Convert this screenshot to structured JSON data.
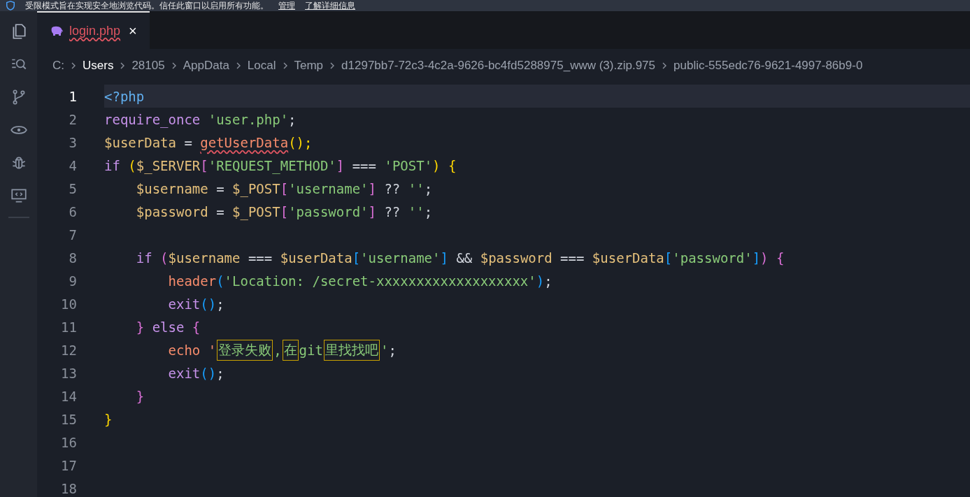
{
  "banner": {
    "message": "受限模式旨在实现安全地浏览代码。信任此窗口以启用所有功能。",
    "links": [
      "管理",
      "了解详细信息"
    ]
  },
  "tabs": [
    {
      "label": "login.php",
      "selected": true,
      "error": true,
      "close": "×"
    }
  ],
  "breadcrumbs": [
    {
      "label": "C:",
      "selected": false
    },
    {
      "label": "Users",
      "selected": true
    },
    {
      "label": "28105",
      "selected": false
    },
    {
      "label": "AppData",
      "selected": false
    },
    {
      "label": "Local",
      "selected": false
    },
    {
      "label": "Temp",
      "selected": false
    },
    {
      "label": "d1297bb7-72c3-4c2a-9626-bc4fd5288975_www (3).zip.975",
      "selected": false
    },
    {
      "label": "public-555edc76-9621-4997-86b9-0",
      "selected": false
    }
  ],
  "lines": [
    {
      "number": "1",
      "active": true,
      "tokens": [
        {
          "text": "<?php",
          "kind": "tag"
        }
      ]
    },
    {
      "number": "2",
      "active": false,
      "tokens": [
        {
          "text": "require_once ",
          "kind": "keyword"
        },
        {
          "text": "'user.php'",
          "kind": "string"
        },
        {
          "text": ";",
          "kind": "plain"
        }
      ]
    },
    {
      "number": "3",
      "active": false,
      "tokens": [
        {
          "text": "$userData",
          "kind": "variable"
        },
        {
          "text": " = ",
          "kind": "plain"
        },
        {
          "text": "getUserData",
          "kind": "function",
          "error": true
        },
        {
          "text": "();",
          "kind": "bracket1"
        }
      ]
    },
    {
      "number": "4",
      "active": false,
      "tokens": [
        {
          "text": "if ",
          "kind": "keyword"
        },
        {
          "text": "(",
          "kind": "bracket1"
        },
        {
          "text": "$_SERVER",
          "kind": "variable"
        },
        {
          "text": "[",
          "kind": "bracket2"
        },
        {
          "text": "'REQUEST_METHOD'",
          "kind": "string"
        },
        {
          "text": "]",
          "kind": "bracket2"
        },
        {
          "text": " === ",
          "kind": "plain"
        },
        {
          "text": "'POST'",
          "kind": "string"
        },
        {
          "text": ") {",
          "kind": "bracket1"
        }
      ]
    },
    {
      "number": "5",
      "active": false,
      "tokens": [
        {
          "text": "    $username",
          "kind": "variable"
        },
        {
          "text": " = ",
          "kind": "plain"
        },
        {
          "text": "$_POST",
          "kind": "variable"
        },
        {
          "text": "[",
          "kind": "bracket2"
        },
        {
          "text": "'username'",
          "kind": "string"
        },
        {
          "text": "]",
          "kind": "bracket2"
        },
        {
          "text": " ?? ",
          "kind": "plain"
        },
        {
          "text": "''",
          "kind": "string"
        },
        {
          "text": ";",
          "kind": "plain"
        }
      ]
    },
    {
      "number": "6",
      "active": false,
      "tokens": [
        {
          "text": "    $password",
          "kind": "variable"
        },
        {
          "text": " = ",
          "kind": "plain"
        },
        {
          "text": "$_POST",
          "kind": "variable"
        },
        {
          "text": "[",
          "kind": "bracket2"
        },
        {
          "text": "'password'",
          "kind": "string"
        },
        {
          "text": "]",
          "kind": "bracket2"
        },
        {
          "text": " ?? ",
          "kind": "plain"
        },
        {
          "text": "''",
          "kind": "string"
        },
        {
          "text": ";",
          "kind": "plain"
        }
      ]
    },
    {
      "number": "7",
      "active": false
    },
    {
      "number": "8",
      "active": false,
      "tokens": [
        {
          "text": "    if ",
          "kind": "keyword"
        },
        {
          "text": "(",
          "kind": "bracket2"
        },
        {
          "text": "$username",
          "kind": "variable"
        },
        {
          "text": " === ",
          "kind": "plain"
        },
        {
          "text": "$userData",
          "kind": "variable"
        },
        {
          "text": "[",
          "kind": "bracket3"
        },
        {
          "text": "'username'",
          "kind": "string"
        },
        {
          "text": "]",
          "kind": "bracket3"
        },
        {
          "text": " && ",
          "kind": "plain"
        },
        {
          "text": "$password",
          "kind": "variable"
        },
        {
          "text": " === ",
          "kind": "plain"
        },
        {
          "text": "$userData",
          "kind": "variable"
        },
        {
          "text": "[",
          "kind": "bracket3"
        },
        {
          "text": "'password'",
          "kind": "string"
        },
        {
          "text": "]",
          "kind": "bracket3"
        },
        {
          "text": ") {",
          "kind": "bracket2"
        }
      ]
    },
    {
      "number": "9",
      "active": false,
      "tokens": [
        {
          "text": "        header",
          "kind": "function"
        },
        {
          "text": "(",
          "kind": "bracket3"
        },
        {
          "text": "'Location: /secret-xxxxxxxxxxxxxxxxxxx'",
          "kind": "string"
        },
        {
          "text": ")",
          "kind": "bracket3"
        },
        {
          "text": ";",
          "kind": "plain"
        }
      ]
    },
    {
      "number": "10",
      "active": false,
      "tokens": [
        {
          "text": "        exit",
          "kind": "keyword"
        },
        {
          "text": "()",
          "kind": "bracket3"
        },
        {
          "text": ";",
          "kind": "plain"
        }
      ]
    },
    {
      "number": "11",
      "active": false,
      "tokens": [
        {
          "text": "    } ",
          "kind": "bracket2"
        },
        {
          "text": "else ",
          "kind": "keyword"
        },
        {
          "text": "{",
          "kind": "bracket2"
        }
      ]
    },
    {
      "number": "12",
      "active": false,
      "tokens": [
        {
          "text": "        echo '",
          "kind": "function"
        },
        {
          "text": "登录失败",
          "kind": "string",
          "boxed": true
        },
        {
          "text": ",",
          "kind": "string"
        },
        {
          "text": "在",
          "kind": "string",
          "boxed": true
        },
        {
          "text": "git",
          "kind": "string"
        },
        {
          "text": "里找找吧",
          "kind": "string",
          "boxed": true
        },
        {
          "text": "'",
          "kind": "string"
        },
        {
          "text": ";",
          "kind": "plain"
        }
      ]
    },
    {
      "number": "13",
      "active": false,
      "tokens": [
        {
          "text": "        exit",
          "kind": "keyword"
        },
        {
          "text": "()",
          "kind": "bracket3"
        },
        {
          "text": ";",
          "kind": "plain"
        }
      ]
    },
    {
      "number": "14",
      "active": false,
      "tokens": [
        {
          "text": "    }",
          "kind": "bracket2"
        }
      ]
    },
    {
      "number": "15",
      "active": false,
      "tokens": [
        {
          "text": "}",
          "kind": "bracket1"
        }
      ]
    },
    {
      "number": "16",
      "active": false
    },
    {
      "number": "17",
      "active": false
    },
    {
      "number": "18",
      "active": false
    }
  ]
}
